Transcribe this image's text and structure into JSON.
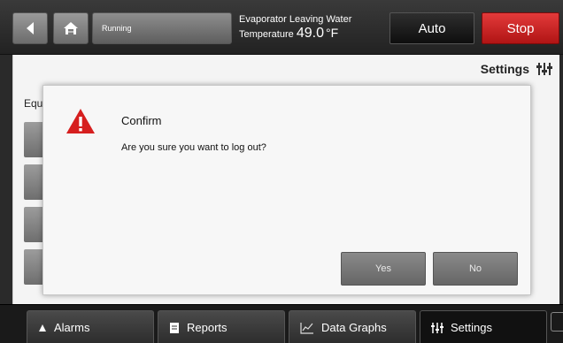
{
  "topbar": {
    "status": "Running",
    "temp_label_line1": "Evaporator Leaving Water",
    "temp_label_line2": "Temperature",
    "temp_value": "49.0",
    "temp_unit": "°F",
    "auto_label": "Auto",
    "stop_label": "Stop"
  },
  "main": {
    "settings_label": "Settings",
    "equipment_label": "Equ"
  },
  "dialog": {
    "title": "Confirm",
    "message": "Are you sure you want to log out?",
    "yes_label": "Yes",
    "no_label": "No"
  },
  "nav": {
    "alarms": "Alarms",
    "reports": "Reports",
    "data_graphs": "Data Graphs",
    "settings": "Settings"
  },
  "colors": {
    "stop": "#c81e1e",
    "warning": "#d61f1f"
  },
  "icons": [
    "back-arrow-icon",
    "home-icon",
    "settings-sliders-icon",
    "warning-icon",
    "bell-icon",
    "report-icon",
    "graph-icon",
    "chat-icon"
  ]
}
